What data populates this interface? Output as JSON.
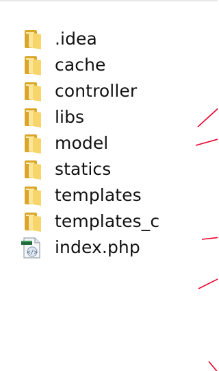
{
  "explorer": {
    "items": [
      {
        "name": ".idea",
        "type": "folder",
        "icon": "folder-icon"
      },
      {
        "name": "cache",
        "type": "folder",
        "icon": "folder-icon"
      },
      {
        "name": "controller",
        "type": "folder",
        "icon": "folder-icon"
      },
      {
        "name": "libs",
        "type": "folder",
        "icon": "folder-icon"
      },
      {
        "name": "model",
        "type": "folder",
        "icon": "folder-icon"
      },
      {
        "name": "statics",
        "type": "folder",
        "icon": "folder-icon"
      },
      {
        "name": "templates",
        "type": "folder",
        "icon": "folder-icon"
      },
      {
        "name": "templates_c",
        "type": "folder",
        "icon": "folder-icon"
      },
      {
        "name": "index.php",
        "type": "file",
        "icon": "php-file-icon"
      }
    ]
  },
  "colors": {
    "folder_back": "#d9a62a",
    "folder_front": "#f7d56a",
    "folder_highlight": "#fff1b8",
    "annotation_line": "#e8002a",
    "text": "#111111"
  }
}
